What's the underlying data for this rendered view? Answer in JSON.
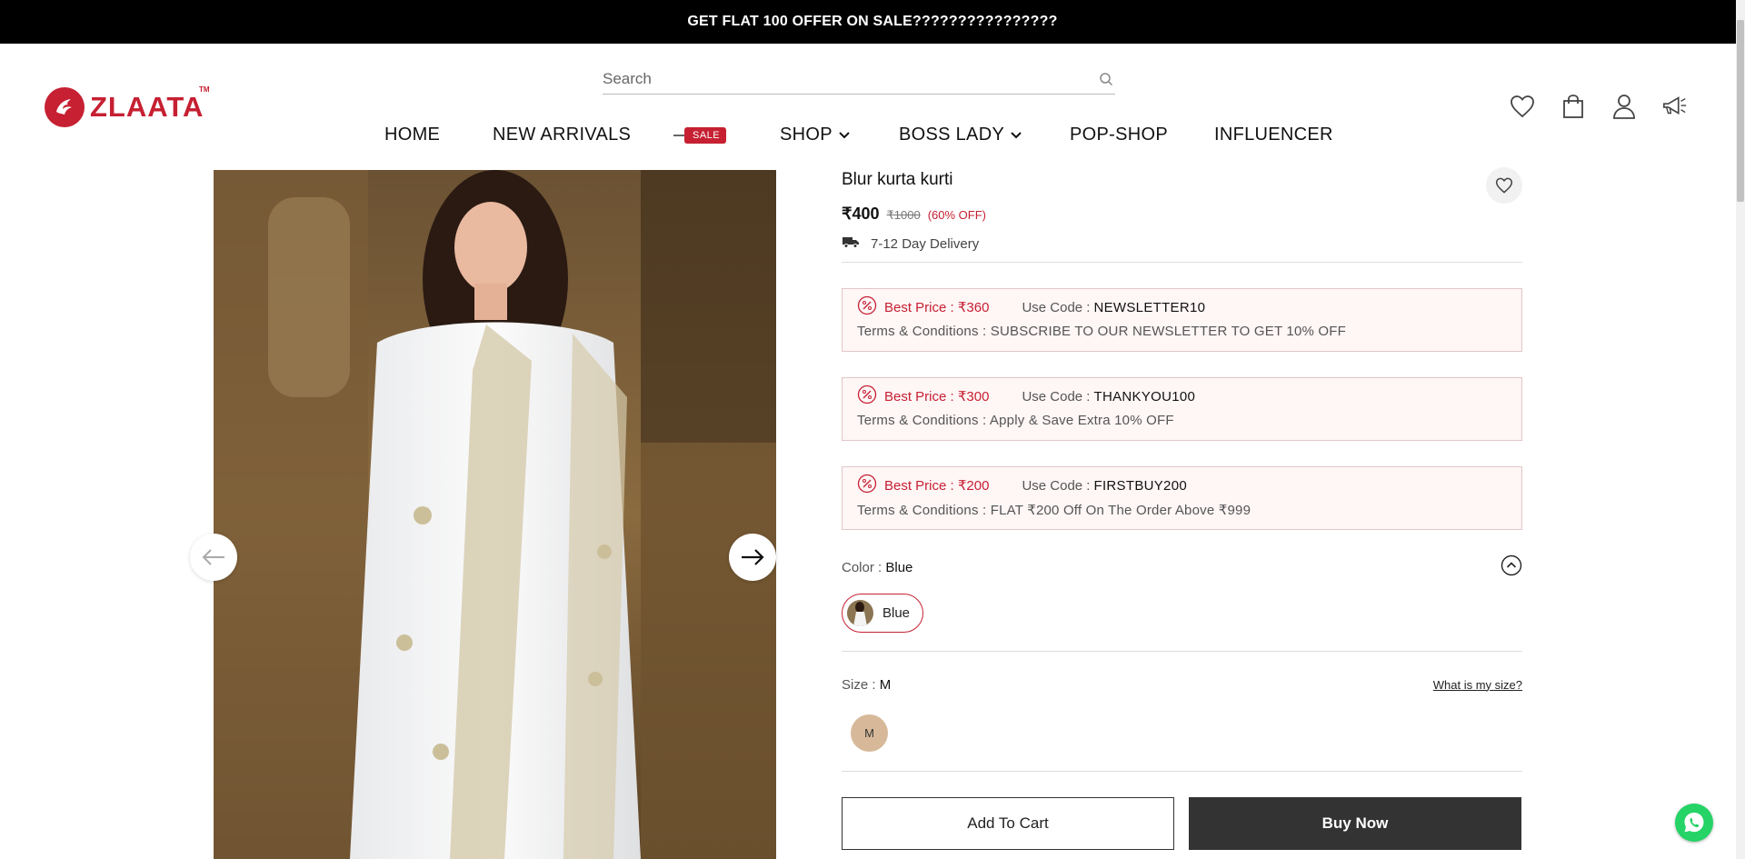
{
  "announcement": "GET FLAT 100 OFFER ON SALE????????????????",
  "brand": {
    "name": "ZLAATA",
    "tm": "TM",
    "color": "#c62032"
  },
  "search": {
    "placeholder": "Search",
    "value": ""
  },
  "nav": {
    "items": [
      {
        "label": "HOME"
      },
      {
        "label": "NEW ARRIVALS"
      },
      {
        "label": "SHOP",
        "dropdown": true
      },
      {
        "label": "BOSS LADY",
        "dropdown": true
      },
      {
        "label": "POP-SHOP"
      },
      {
        "label": "INFLUENCER"
      }
    ],
    "sale_badge": "SALE"
  },
  "header_icons": [
    "heart-icon",
    "shopping-bag-icon",
    "user-icon",
    "megaphone-icon"
  ],
  "product": {
    "title": "Blur kurta kurti",
    "price": "₹400",
    "mrp": "₹1000",
    "discount": "(60% OFF)",
    "delivery": "7-12 Day Delivery",
    "offers": [
      {
        "best_price": "Best Price : ₹360",
        "code_label": "Use Code :",
        "code": "NEWSLETTER10",
        "terms": "Terms & Conditions : SUBSCRIBE TO OUR NEWSLETTER TO GET 10% OFF"
      },
      {
        "best_price": "Best Price : ₹300",
        "code_label": "Use Code :",
        "code": "THANKYOU100",
        "terms": "Terms & Conditions : Apply & Save Extra 10% OFF"
      },
      {
        "best_price": "Best Price : ₹200",
        "code_label": "Use Code :",
        "code": "FIRSTBUY200",
        "terms": "Terms & Conditions : FLAT ₹200 Off On The Order Above ₹999"
      }
    ],
    "color_label": "Color :",
    "color_value": "Blue",
    "color_options": [
      "Blue"
    ],
    "size_label": "Size :",
    "size_value": "M",
    "size_link": "What is my size?",
    "size_options": [
      "M"
    ],
    "add_to_cart": "Add To Cart",
    "buy_now": "Buy Now"
  }
}
